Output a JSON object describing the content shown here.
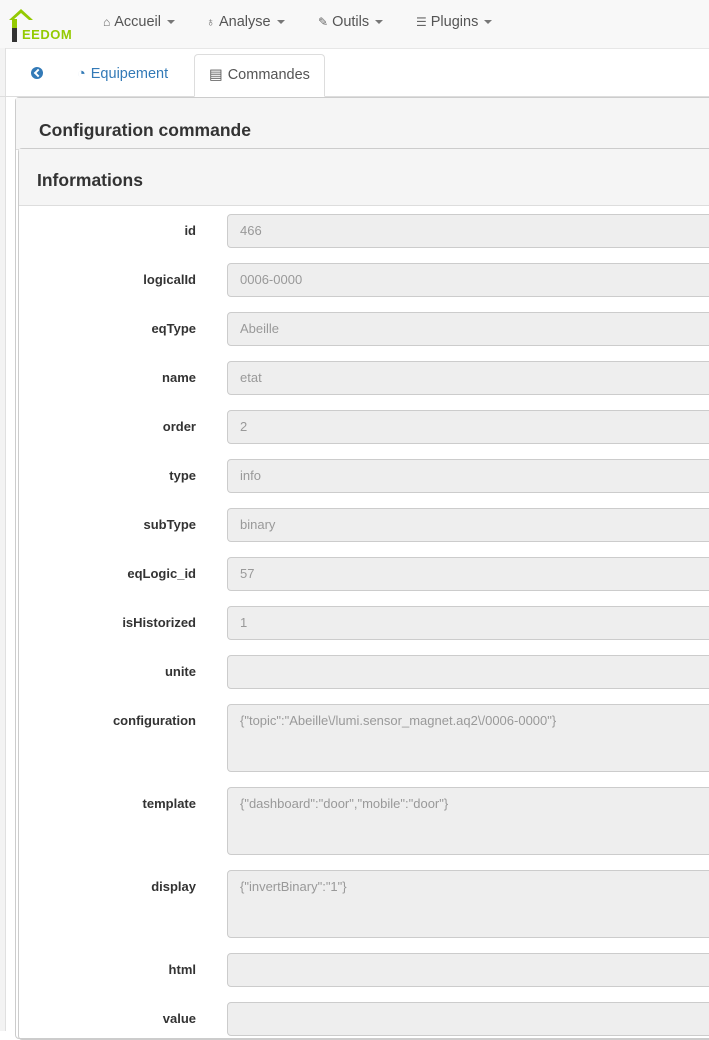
{
  "nav": {
    "brand": "EEDOM",
    "items": [
      {
        "label": "Accueil",
        "icon": "home-icon"
      },
      {
        "label": "Analyse",
        "icon": "stethoscope-icon"
      },
      {
        "label": "Outils",
        "icon": "wrench-icon"
      },
      {
        "label": "Plugins",
        "icon": "tasks-icon"
      }
    ]
  },
  "tabs": {
    "equipement": "Equipement",
    "commandes": "Commandes"
  },
  "panel": {
    "title": "Configuration commande",
    "section": "Informations"
  },
  "fields": [
    {
      "label": "id",
      "value": "466"
    },
    {
      "label": "logicalId",
      "value": "0006-0000"
    },
    {
      "label": "eqType",
      "value": "Abeille"
    },
    {
      "label": "name",
      "value": "etat"
    },
    {
      "label": "order",
      "value": "2"
    },
    {
      "label": "type",
      "value": "info"
    },
    {
      "label": "subType",
      "value": "binary"
    },
    {
      "label": "eqLogic_id",
      "value": "57"
    },
    {
      "label": "isHistorized",
      "value": "1"
    },
    {
      "label": "unite",
      "value": ""
    },
    {
      "label": "configuration",
      "value": "{\"topic\":\"Abeille\\/lumi.sensor_magnet.aq2\\/0006-0000\"}"
    },
    {
      "label": "template",
      "value": "{\"dashboard\":\"door\",\"mobile\":\"door\"}"
    },
    {
      "label": "display",
      "value": "{\"invertBinary\":\"1\"}"
    },
    {
      "label": "html",
      "value": ""
    },
    {
      "label": "value",
      "value": ""
    }
  ]
}
